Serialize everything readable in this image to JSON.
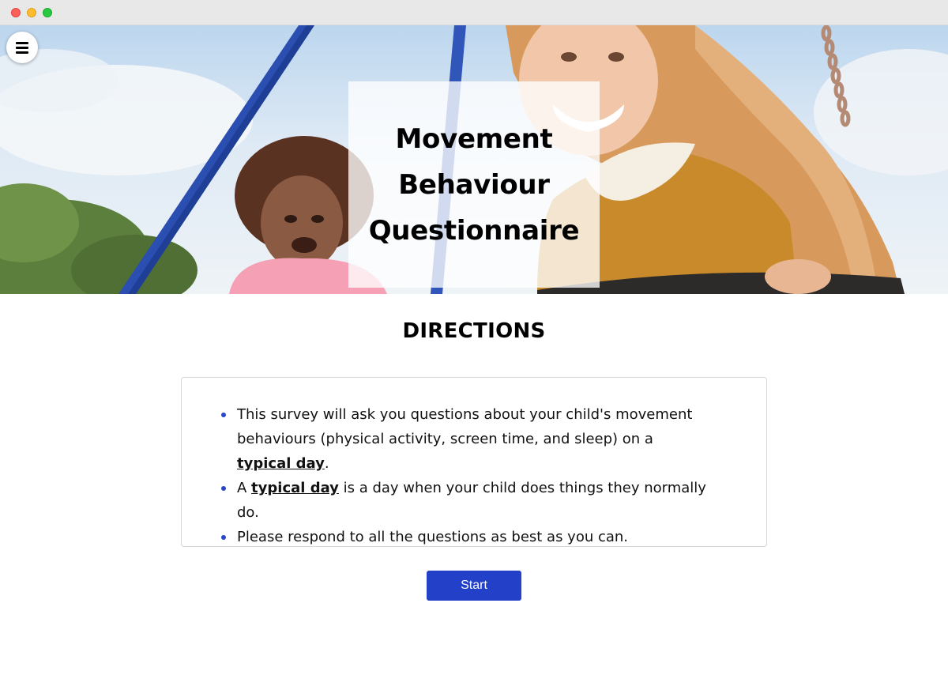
{
  "window": {
    "controls": [
      "close",
      "minimize",
      "maximize"
    ]
  },
  "menu": {
    "icon": "hamburger-menu-icon"
  },
  "hero": {
    "title_line1": "Movement",
    "title_line2": "Behaviour",
    "title_line3": "Questionnaire"
  },
  "directions": {
    "heading": "DIRECTIONS",
    "item1_text_a": "This survey will ask you questions about your child's movement behaviours (physical activity, screen time, and sleep) on a ",
    "item1_emphasis": "typical day",
    "item1_text_b": ".",
    "item2_text_a": "A ",
    "item2_emphasis": "typical day",
    "item2_text_b": " is a day when your child does things they normally do.",
    "item3_text": "Please respond to all the questions as best as you can."
  },
  "actions": {
    "start_label": "Start"
  },
  "colors": {
    "accent": "#2340c8",
    "bullet": "#2a46c8",
    "titlebar": "#e8e8e8"
  }
}
